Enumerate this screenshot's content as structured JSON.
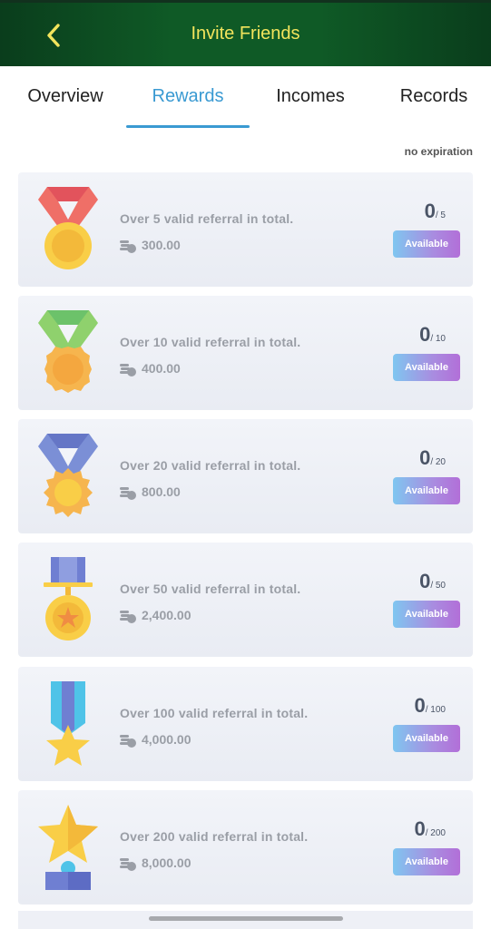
{
  "header": {
    "title": "Invite Friends",
    "back_icon": "chevron-left-icon"
  },
  "tabs": [
    {
      "label": "Overview",
      "active": false
    },
    {
      "label": "Rewards",
      "active": true
    },
    {
      "label": "Incomes",
      "active": false
    },
    {
      "label": "Records",
      "active": false
    }
  ],
  "expiration_note": "no expiration",
  "rewards": [
    {
      "description": "Over 5 valid referral in total.",
      "amount": "300.00",
      "current": "0",
      "target": "/ 5",
      "button": "Available",
      "medal": "red-ribbon-gold-medal-icon"
    },
    {
      "description": "Over 10 valid referral in total.",
      "amount": "400.00",
      "current": "0",
      "target": "/ 10",
      "button": "Available",
      "medal": "green-ribbon-orange-medal-icon"
    },
    {
      "description": "Over 20 valid referral in total.",
      "amount": "800.00",
      "current": "0",
      "target": "/ 20",
      "button": "Available",
      "medal": "blue-ribbon-gear-medal-icon"
    },
    {
      "description": "Over 50 valid referral in total.",
      "amount": "2,400.00",
      "current": "0",
      "target": "/ 50",
      "button": "Available",
      "medal": "bar-star-medal-icon"
    },
    {
      "description": "Over 100 valid referral in total.",
      "amount": "4,000.00",
      "current": "0",
      "target": "/ 100",
      "button": "Available",
      "medal": "ribbon-star-medal-icon"
    },
    {
      "description": "Over 200 valid referral in total.",
      "amount": "8,000.00",
      "current": "0",
      "target": "/ 200",
      "button": "Available",
      "medal": "star-trophy-icon"
    }
  ],
  "colors": {
    "header_bg": "#0f5a26",
    "header_title": "#f2e45c",
    "tab_active": "#3a9ad2",
    "button_gradient_start": "#7fc6f0",
    "button_gradient_end": "#b26fd8"
  }
}
